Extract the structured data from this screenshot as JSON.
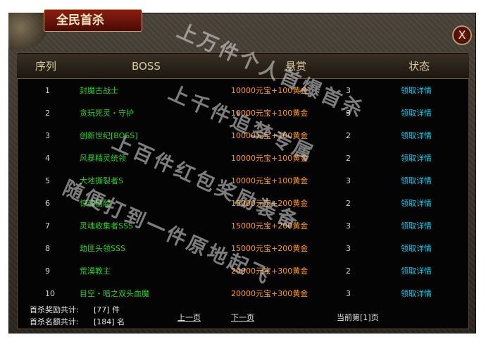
{
  "window": {
    "title": "全民首杀",
    "close_symbol": "X"
  },
  "table": {
    "headers": {
      "index": "序列",
      "boss": "BOSS",
      "reward": "悬赏",
      "state": "状态"
    },
    "rows": [
      {
        "index": "1",
        "boss": "封魔古战士",
        "reward": "10000元宝+100黄金",
        "state": "3",
        "action": "领取详情"
      },
      {
        "index": "2",
        "boss": "贪玩死灵・守护",
        "reward": "10000元宝+100黄金",
        "state": "3",
        "action": "领取详情"
      },
      {
        "index": "3",
        "boss": "创新世纪[BOSS]",
        "reward": "10000元宝+100黄金",
        "state": "2",
        "action": "领取详情"
      },
      {
        "index": "4",
        "boss": "风暴精灵统领",
        "reward": "10000元宝+100黄金",
        "state": "2",
        "action": "领取详情"
      },
      {
        "index": "5",
        "boss": "大地撕裂者S",
        "reward": "10000元宝+100黄金",
        "state": "3",
        "action": "领取详情"
      },
      {
        "index": "6",
        "boss": "惊魂骷髅",
        "reward": "15000元宝+200黄金",
        "state": "2",
        "action": "领取详情"
      },
      {
        "index": "7",
        "boss": "灵魂收集者SSS",
        "reward": "15000元宝+200黄金",
        "state": "3",
        "action": "领取详情"
      },
      {
        "index": "8",
        "boss": "劫匪头领SSS",
        "reward": "15000元宝+200黄金",
        "state": "3",
        "action": "领取详情"
      },
      {
        "index": "9",
        "boss": "荒漠教主",
        "reward": "20000元宝+300黄金",
        "state": "2",
        "action": "领取详情"
      },
      {
        "index": "10",
        "boss": "目空・暗之双头血魔",
        "reward": "20000元宝+300黄金",
        "state": "3",
        "action": "领取详情"
      }
    ]
  },
  "footer": {
    "reward_total_label": "首杀奖励共计:",
    "reward_total_value": "[77] 件",
    "quota_total_label": "首杀名额共计:",
    "quota_total_value": "[184] 名",
    "prev_page": "上一页",
    "next_page": "下一页",
    "current_page": "当前第[1]页"
  },
  "watermark": {
    "line1": "上万件个人首爆首杀",
    "line2": "上千件追梦专属",
    "line3": "上百件红包奖励装备",
    "line4": "随便打到一件原地起飞"
  }
}
